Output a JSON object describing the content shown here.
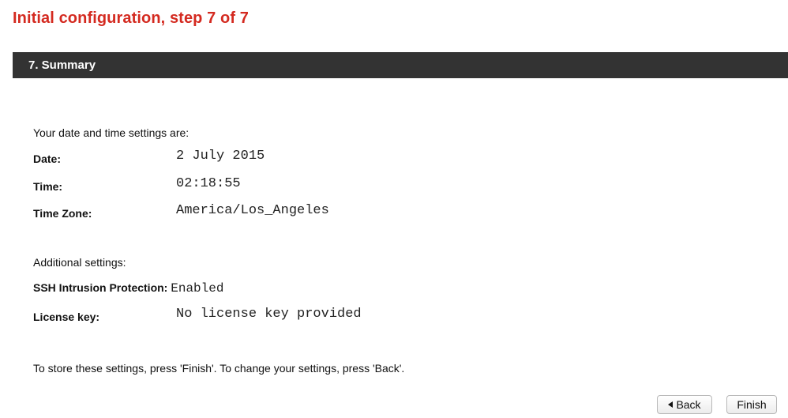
{
  "page": {
    "title": "Initial configuration, step 7 of 7"
  },
  "section": {
    "title": "7. Summary"
  },
  "datetime": {
    "intro": "Your date and time settings are:",
    "date_label": "Date:",
    "date_value": "2 July 2015",
    "time_label": "Time:",
    "time_value": "02:18:55",
    "timezone_label": "Time Zone:",
    "timezone_value": "America/Los_Angeles"
  },
  "additional": {
    "intro": "Additional settings:",
    "ssh_label": "SSH Intrusion Protection:",
    "ssh_value": "Enabled",
    "license_label": "License key:",
    "license_value": "No license key provided"
  },
  "footer": {
    "instructions": "To store these settings, press 'Finish'. To change your settings, press 'Back'."
  },
  "buttons": {
    "back_label": "Back",
    "finish_label": "Finish"
  },
  "colors": {
    "title": "#d42a20",
    "section_bar": "#333333"
  },
  "icons": {
    "back": "left-triangle-icon"
  }
}
